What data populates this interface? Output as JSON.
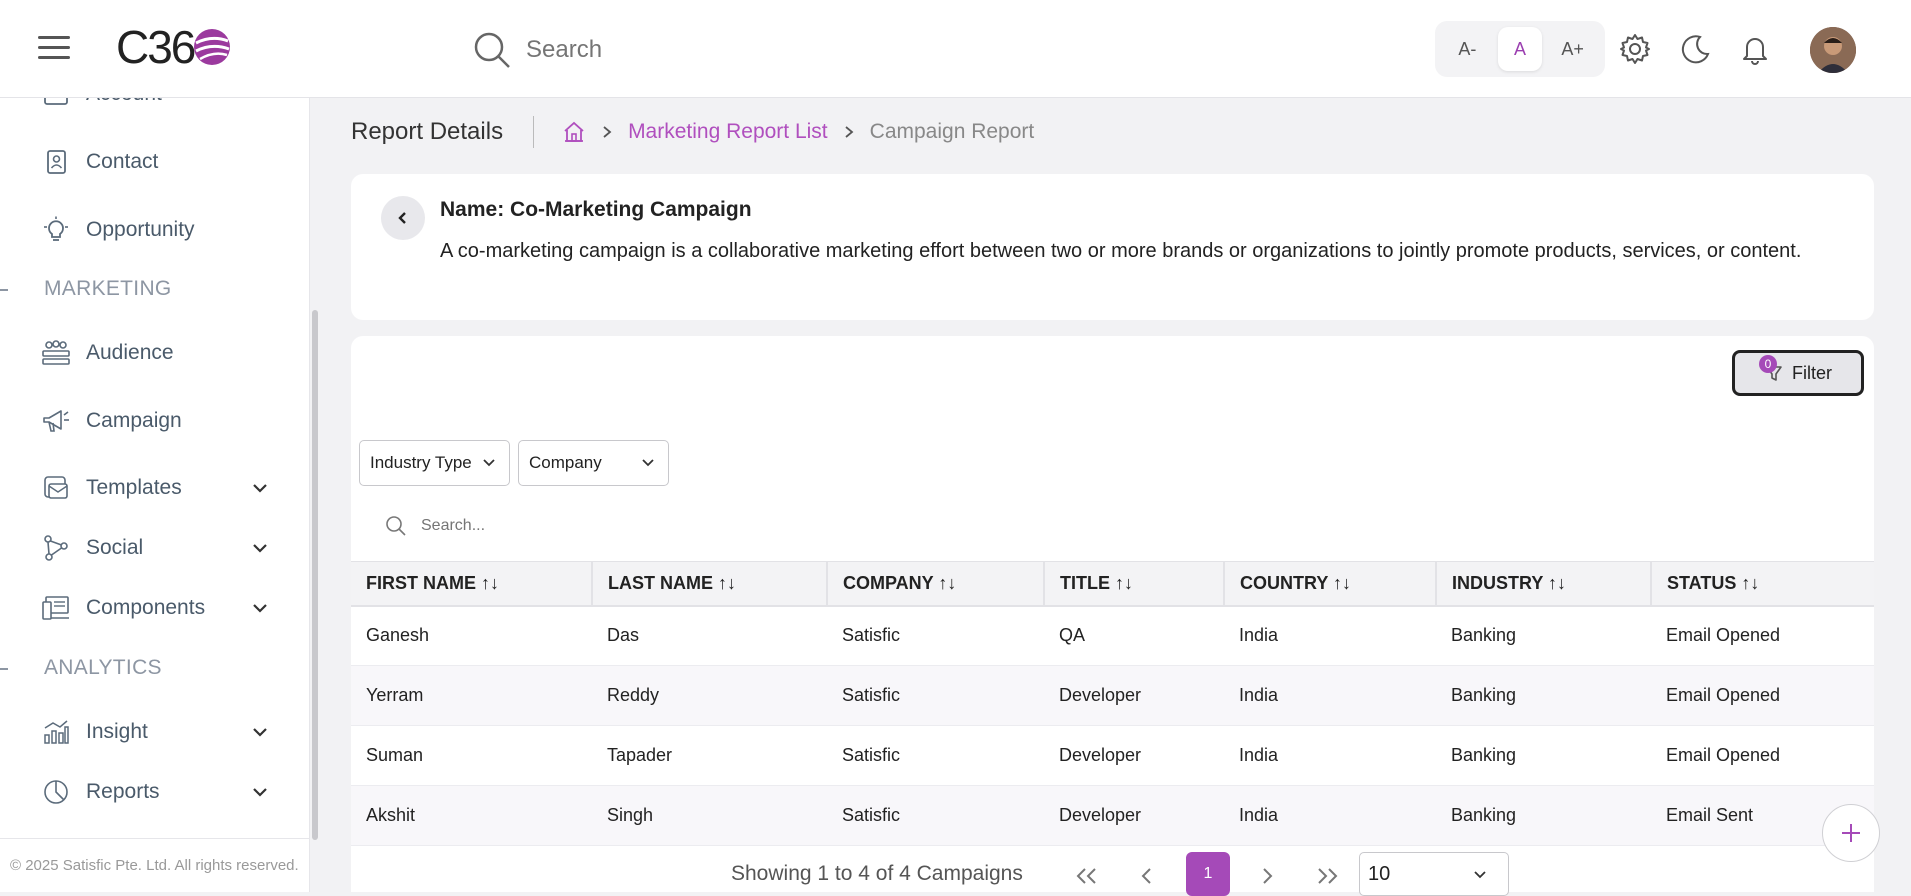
{
  "header": {
    "logo_text": "C36",
    "search_placeholder": "Search",
    "font_small": "A-",
    "font_normal": "A",
    "font_large": "A+"
  },
  "sidebar": {
    "items_top": [
      {
        "label": "Account",
        "icon": "account-icon"
      },
      {
        "label": "Contact",
        "icon": "contact-icon"
      },
      {
        "label": "Opportunity",
        "icon": "lightbulb-icon"
      }
    ],
    "section_marketing": "MARKETING",
    "marketing_items": [
      {
        "label": "Audience",
        "icon": "audience-icon"
      },
      {
        "label": "Campaign",
        "icon": "megaphone-icon"
      },
      {
        "label": "Templates",
        "icon": "templates-icon"
      },
      {
        "label": "Social",
        "icon": "social-icon"
      },
      {
        "label": "Components",
        "icon": "components-icon"
      }
    ],
    "section_analytics": "ANALYTICS",
    "analytics_items": [
      {
        "label": "Insight",
        "icon": "insight-icon"
      },
      {
        "label": "Reports",
        "icon": "reports-icon"
      }
    ],
    "copyright": "© 2025 Satisfic Pte. Ltd. All rights reserved."
  },
  "breadcrumb": {
    "title": "Report Details",
    "link": "Marketing Report List",
    "current": "Campaign Report"
  },
  "campaign": {
    "name": "Name: Co-Marketing Campaign",
    "description": "A co-marketing campaign is a collaborative marketing effort between two or more brands or organizations to jointly promote products, services, or content."
  },
  "filters": {
    "filter_label": "Filter",
    "filter_count": "0",
    "industry_type": "Industry Type",
    "company": "Company",
    "search_placeholder": "Search..."
  },
  "table": {
    "columns": [
      "FIRST NAME",
      "LAST NAME",
      "COMPANY",
      "TITLE",
      "COUNTRY",
      "INDUSTRY",
      "STATUS"
    ],
    "rows": [
      [
        "Ganesh",
        "Das",
        "Satisfic",
        "QA",
        "India",
        "Banking",
        "Email Opened"
      ],
      [
        "Yerram",
        "Reddy",
        "Satisfic",
        "Developer",
        "India",
        "Banking",
        "Email Opened"
      ],
      [
        "Suman",
        "Tapader",
        "Satisfic",
        "Developer",
        "India",
        "Banking",
        "Email Opened"
      ],
      [
        "Akshit",
        "Singh",
        "Satisfic",
        "Developer",
        "India",
        "Banking",
        "Email Sent"
      ]
    ]
  },
  "pagination": {
    "summary": "Showing 1 to 4 of 4 Campaigns",
    "current_page": "1",
    "page_size": "10"
  },
  "colors": {
    "accent": "#a54ab8"
  }
}
